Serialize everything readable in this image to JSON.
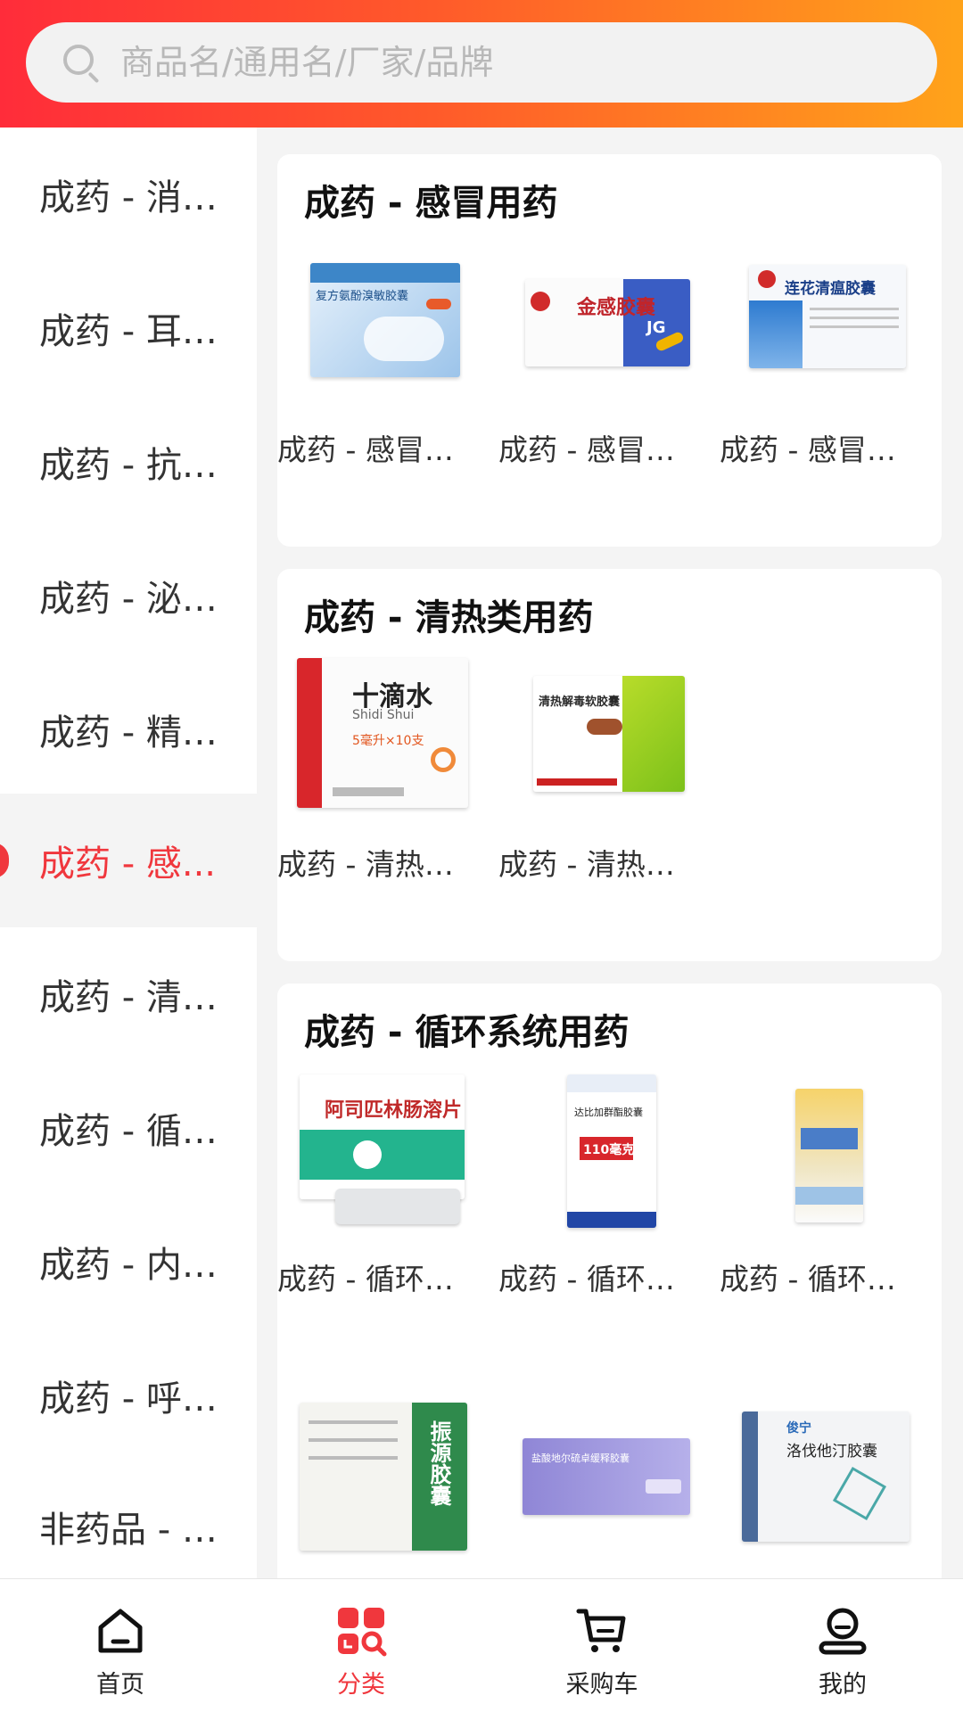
{
  "search": {
    "placeholder": "商品名/通用名/厂家/品牌"
  },
  "sidebar": {
    "items": [
      {
        "label": "成药 - 消化..."
      },
      {
        "label": "成药 - 耳鼻..."
      },
      {
        "label": "成药 - 抗感..."
      },
      {
        "label": "成药 - 泌尿..."
      },
      {
        "label": "成药 - 精神..."
      },
      {
        "label": "成药 - 感...",
        "active": true
      },
      {
        "label": "成药 - 清热..."
      },
      {
        "label": "成药 - 循环..."
      },
      {
        "label": "成药 - 内分..."
      },
      {
        "label": "成药 - 呼吸..."
      },
      {
        "label": "非药品 - 保..."
      }
    ]
  },
  "sections": [
    {
      "title": "成药 - 感冒用药",
      "products": [
        {
          "name": "成药 - 感冒用...",
          "box_text": "复方氨酚溴敏胶囊"
        },
        {
          "name": "成药 - 感冒用...",
          "box_text": "金感胶囊"
        },
        {
          "name": "成药 - 感冒用...",
          "box_text": "连花清瘟胶囊"
        }
      ]
    },
    {
      "title": "成药 - 清热类用药",
      "products": [
        {
          "name": "成药 - 清热类...",
          "box_text": "十滴水",
          "box_sub": "Shidi Shui",
          "box_qty": "5毫升×10支"
        },
        {
          "name": "成药 - 清热类...",
          "box_text": "清热解毒软胶囊"
        }
      ]
    },
    {
      "title": "成药 - 循环系统用药",
      "products": [
        {
          "name": "成药 - 循环系...",
          "box_text": "阿司匹林肠溶片"
        },
        {
          "name": "成药 - 循环系...",
          "box_text": "达比加群酯胶囊",
          "box_badge": "110毫克"
        },
        {
          "name": "成药 - 循环系...",
          "box_text": ""
        }
      ],
      "more_products": [
        {
          "box_text": "振源胶囊"
        },
        {
          "box_text": "盐酸地尔硫卓缓释胶囊"
        },
        {
          "box_text": "洛伐他汀胶囊",
          "box_brand": "俊宁"
        }
      ]
    }
  ],
  "tabbar": {
    "tabs": [
      {
        "label": "首页",
        "icon": "home-icon"
      },
      {
        "label": "分类",
        "icon": "category-icon",
        "active": true
      },
      {
        "label": "采购车",
        "icon": "cart-icon"
      },
      {
        "label": "我的",
        "icon": "profile-icon"
      }
    ]
  },
  "colors": {
    "accent": "#f0373d",
    "header_start": "#ff2c3a",
    "header_end": "#ffa31a"
  }
}
